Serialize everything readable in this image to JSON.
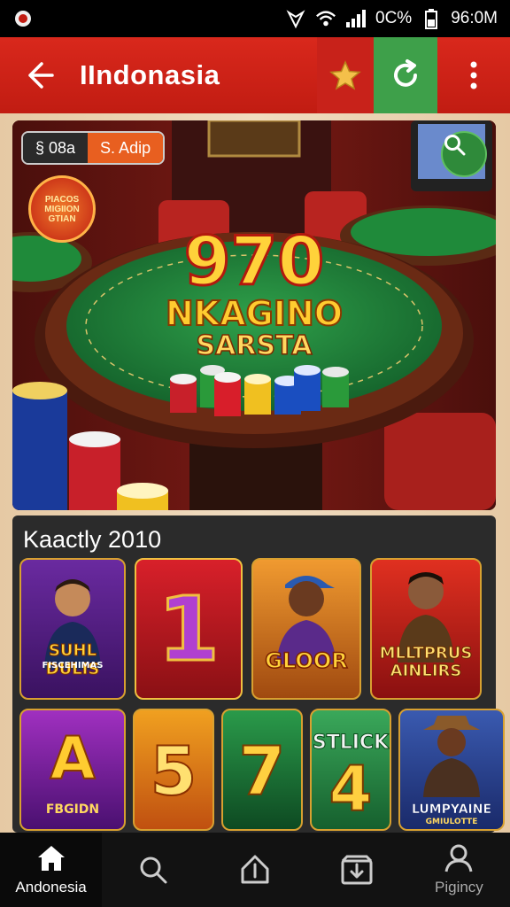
{
  "status_bar": {
    "battery_text": "0C%",
    "time": "96:0M"
  },
  "toolbar": {
    "title": "IIndonasia"
  },
  "banner": {
    "pill_left": "§ 08a",
    "pill_right": "S. Adip",
    "badge_text_1": "PIACOS",
    "badge_text_2": "MIGIION",
    "badge_text_3": "GTIAN",
    "title_number": "970",
    "title_line1": "NKAGINO",
    "title_line2": "SARSTA"
  },
  "section": {
    "title": "Kaactly 2010",
    "row1": [
      {
        "label": "SUHL DULIS",
        "sublabel": "FISCEHIMAS"
      },
      {
        "label": "1"
      },
      {
        "label": "GLOOR"
      },
      {
        "label": "MLLTPRUS AINLIRS"
      }
    ],
    "row2": [
      {
        "label": "A",
        "sublabel": "FBGIDN"
      },
      {
        "label": "5"
      },
      {
        "label": "7"
      },
      {
        "label": "4",
        "toplabel": "STLICK"
      },
      {
        "label": "LUMPYAINE",
        "sublabel": "GMIULOTTE"
      }
    ]
  },
  "bottom_nav": {
    "home_label": "Andonesia",
    "profile_label": "Pigincy"
  },
  "colors": {
    "toolbar_red": "#c11c12",
    "refresh_green": "#3ea04a",
    "section_bg": "#2b2b2b"
  }
}
